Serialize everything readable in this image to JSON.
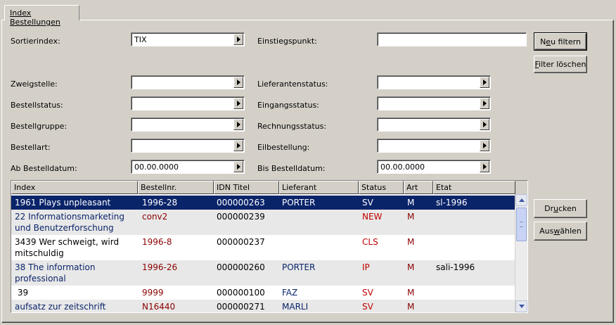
{
  "tab": {
    "label": "Index Bestellungen"
  },
  "filters": {
    "sortierindex": {
      "label": "Sortierindex:",
      "value": "TIX"
    },
    "einstiegspunkt": {
      "label": "Einstiegspunkt:",
      "value": ""
    },
    "zweigstelle": {
      "label": "Zweigstelle:",
      "value": ""
    },
    "lieferantenstatus": {
      "label": "Lieferantenstatus:",
      "value": ""
    },
    "bestellstatus": {
      "label": "Bestellstatus:",
      "value": ""
    },
    "eingangsstatus": {
      "label": "Eingangsstatus:",
      "value": ""
    },
    "bestellgruppe": {
      "label": "Bestellgruppe:",
      "value": ""
    },
    "rechnungsstatus": {
      "label": "Rechnungsstatus:",
      "value": ""
    },
    "bestellart": {
      "label": "Bestellart:",
      "value": ""
    },
    "eilbestellung": {
      "label": "Eilbestellung:",
      "value": ""
    },
    "ab_bestelldatum": {
      "label": "Ab Bestelldatum:",
      "value": "00.00.0000"
    },
    "bis_bestelldatum": {
      "label": "Bis Bestelldatum:",
      "value": "00.00.0000"
    }
  },
  "buttons": {
    "neu_filtern_pre": "N",
    "neu_filtern_ul": "e",
    "neu_filtern_post": "u filtern",
    "filter_loeschen_pre": "",
    "filter_loeschen_ul": "F",
    "filter_loeschen_post": "ilter löschen",
    "drucken_pre": "Dr",
    "drucken_ul": "u",
    "drucken_post": "cken",
    "auswaehlen_pre": "Aus",
    "auswaehlen_ul": "w",
    "auswaehlen_post": "ählen"
  },
  "grid": {
    "columns": [
      "Index",
      "Bestellnr.",
      "IDN Titel",
      "Lieferant",
      "Status",
      "Art",
      "Etat"
    ],
    "rows": [
      {
        "index1": "1961 Plays unpleasant",
        "index2": "",
        "bestellnr": "1996-28",
        "idn": "000000263",
        "lieferant": "PORTER",
        "status": "SV",
        "art": "M",
        "etat": "sl-1996"
      },
      {
        "index1": "22 Informationsmarketing",
        "index2": "und Benutzerforschung",
        "bestellnr": "conv2",
        "idn": "000000239",
        "lieferant": "",
        "status": "NEW",
        "art": "M",
        "etat": ""
      },
      {
        "index1": "3439 Wer schweigt, wird",
        "index2": "mitschuldig",
        "bestellnr": "1996-8",
        "idn": "000000237",
        "lieferant": "",
        "status": "CLS",
        "art": "M",
        "etat": ""
      },
      {
        "index1": "38 The information",
        "index2": "professional",
        "bestellnr": "1996-26",
        "idn": "000000260",
        "lieferant": "PORTER",
        "status": "IP",
        "art": "M",
        "etat": "sali-1996"
      },
      {
        "index1": " 39",
        "index2": "",
        "bestellnr": "9999",
        "idn": "000000100",
        "lieferant": "FAZ",
        "status": "SV",
        "art": "M",
        "etat": ""
      },
      {
        "index1": "aufsatz zur zeitschrift",
        "index2": "",
        "bestellnr": "N16440",
        "idn": "000000271",
        "lieferant": "MARLI",
        "status": "SV",
        "art": "M",
        "etat": ""
      }
    ]
  }
}
